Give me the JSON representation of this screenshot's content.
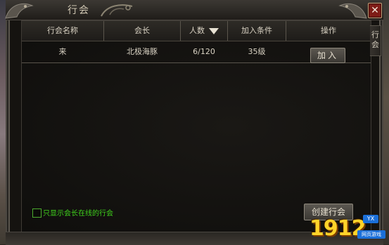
{
  "window": {
    "title": "行会",
    "close_label": "✕"
  },
  "side_tab": {
    "label": "行会"
  },
  "table": {
    "headers": {
      "name": "行会名称",
      "leader": "会长",
      "members": "人数",
      "requirement": "加入条件",
      "action": "操作"
    },
    "rows": [
      {
        "name": "来",
        "leader": "北极海豚",
        "members": "6/120",
        "requirement": "35级",
        "action": "加入"
      }
    ]
  },
  "footer": {
    "online_only_label": "只显示会长在线的行会",
    "online_only_checked": false,
    "create_button": "创建行会"
  },
  "watermark": {
    "number": "1912",
    "badge": "YX",
    "sub": "网页游戏"
  },
  "colors": {
    "accent_green": "#3fd11c",
    "close_red": "#7e1c16",
    "text": "#d9d2c3"
  }
}
